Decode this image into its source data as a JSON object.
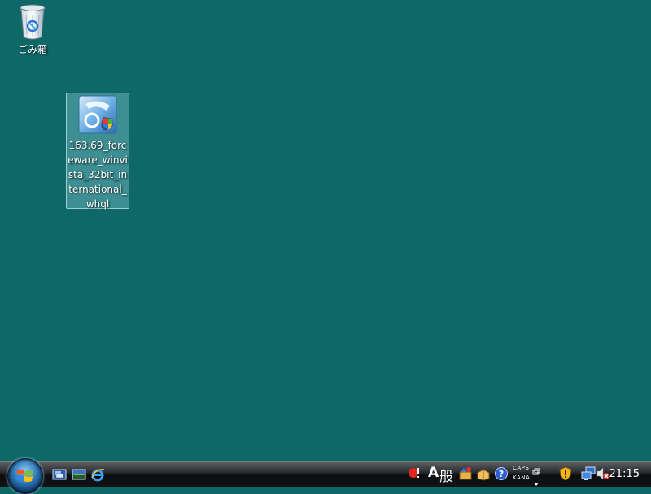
{
  "desktop": {
    "background_color": "#0e6868",
    "icons": [
      {
        "label": "ごみ箱",
        "icon": "recycle-bin-icon"
      },
      {
        "label": "163.69_forceware_winvista_32bit_international_whql",
        "icon": "installer-shield-icon",
        "selected": true
      }
    ]
  },
  "taskbar": {
    "start_icon": "windows-start-orb-icon",
    "quicklaunch": [
      "show-desktop-icon",
      "switch-windows-icon",
      "internet-explorer-icon"
    ],
    "tray": {
      "ime_mode": "A",
      "ime_kanji": "般",
      "caps_label": "CAPS",
      "kana_label": "KANA",
      "clock": "21:15"
    }
  }
}
